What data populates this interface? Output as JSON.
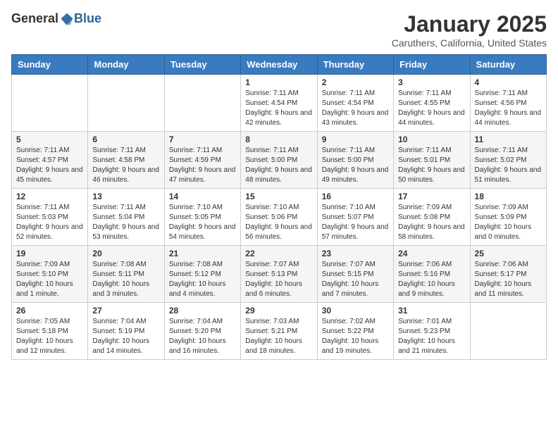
{
  "header": {
    "logo_general": "General",
    "logo_blue": "Blue",
    "month_title": "January 2025",
    "location": "Caruthers, California, United States"
  },
  "weekdays": [
    "Sunday",
    "Monday",
    "Tuesday",
    "Wednesday",
    "Thursday",
    "Friday",
    "Saturday"
  ],
  "weeks": [
    [
      {
        "day": "",
        "info": ""
      },
      {
        "day": "",
        "info": ""
      },
      {
        "day": "",
        "info": ""
      },
      {
        "day": "1",
        "info": "Sunrise: 7:11 AM\nSunset: 4:54 PM\nDaylight: 9 hours and 42 minutes."
      },
      {
        "day": "2",
        "info": "Sunrise: 7:11 AM\nSunset: 4:54 PM\nDaylight: 9 hours and 43 minutes."
      },
      {
        "day": "3",
        "info": "Sunrise: 7:11 AM\nSunset: 4:55 PM\nDaylight: 9 hours and 44 minutes."
      },
      {
        "day": "4",
        "info": "Sunrise: 7:11 AM\nSunset: 4:56 PM\nDaylight: 9 hours and 44 minutes."
      }
    ],
    [
      {
        "day": "5",
        "info": "Sunrise: 7:11 AM\nSunset: 4:57 PM\nDaylight: 9 hours and 45 minutes."
      },
      {
        "day": "6",
        "info": "Sunrise: 7:11 AM\nSunset: 4:58 PM\nDaylight: 9 hours and 46 minutes."
      },
      {
        "day": "7",
        "info": "Sunrise: 7:11 AM\nSunset: 4:59 PM\nDaylight: 9 hours and 47 minutes."
      },
      {
        "day": "8",
        "info": "Sunrise: 7:11 AM\nSunset: 5:00 PM\nDaylight: 9 hours and 48 minutes."
      },
      {
        "day": "9",
        "info": "Sunrise: 7:11 AM\nSunset: 5:00 PM\nDaylight: 9 hours and 49 minutes."
      },
      {
        "day": "10",
        "info": "Sunrise: 7:11 AM\nSunset: 5:01 PM\nDaylight: 9 hours and 50 minutes."
      },
      {
        "day": "11",
        "info": "Sunrise: 7:11 AM\nSunset: 5:02 PM\nDaylight: 9 hours and 51 minutes."
      }
    ],
    [
      {
        "day": "12",
        "info": "Sunrise: 7:11 AM\nSunset: 5:03 PM\nDaylight: 9 hours and 52 minutes."
      },
      {
        "day": "13",
        "info": "Sunrise: 7:11 AM\nSunset: 5:04 PM\nDaylight: 9 hours and 53 minutes."
      },
      {
        "day": "14",
        "info": "Sunrise: 7:10 AM\nSunset: 5:05 PM\nDaylight: 9 hours and 54 minutes."
      },
      {
        "day": "15",
        "info": "Sunrise: 7:10 AM\nSunset: 5:06 PM\nDaylight: 9 hours and 56 minutes."
      },
      {
        "day": "16",
        "info": "Sunrise: 7:10 AM\nSunset: 5:07 PM\nDaylight: 9 hours and 57 minutes."
      },
      {
        "day": "17",
        "info": "Sunrise: 7:09 AM\nSunset: 5:08 PM\nDaylight: 9 hours and 58 minutes."
      },
      {
        "day": "18",
        "info": "Sunrise: 7:09 AM\nSunset: 5:09 PM\nDaylight: 10 hours and 0 minutes."
      }
    ],
    [
      {
        "day": "19",
        "info": "Sunrise: 7:09 AM\nSunset: 5:10 PM\nDaylight: 10 hours and 1 minute."
      },
      {
        "day": "20",
        "info": "Sunrise: 7:08 AM\nSunset: 5:11 PM\nDaylight: 10 hours and 3 minutes."
      },
      {
        "day": "21",
        "info": "Sunrise: 7:08 AM\nSunset: 5:12 PM\nDaylight: 10 hours and 4 minutes."
      },
      {
        "day": "22",
        "info": "Sunrise: 7:07 AM\nSunset: 5:13 PM\nDaylight: 10 hours and 6 minutes."
      },
      {
        "day": "23",
        "info": "Sunrise: 7:07 AM\nSunset: 5:15 PM\nDaylight: 10 hours and 7 minutes."
      },
      {
        "day": "24",
        "info": "Sunrise: 7:06 AM\nSunset: 5:16 PM\nDaylight: 10 hours and 9 minutes."
      },
      {
        "day": "25",
        "info": "Sunrise: 7:06 AM\nSunset: 5:17 PM\nDaylight: 10 hours and 11 minutes."
      }
    ],
    [
      {
        "day": "26",
        "info": "Sunrise: 7:05 AM\nSunset: 5:18 PM\nDaylight: 10 hours and 12 minutes."
      },
      {
        "day": "27",
        "info": "Sunrise: 7:04 AM\nSunset: 5:19 PM\nDaylight: 10 hours and 14 minutes."
      },
      {
        "day": "28",
        "info": "Sunrise: 7:04 AM\nSunset: 5:20 PM\nDaylight: 10 hours and 16 minutes."
      },
      {
        "day": "29",
        "info": "Sunrise: 7:03 AM\nSunset: 5:21 PM\nDaylight: 10 hours and 18 minutes."
      },
      {
        "day": "30",
        "info": "Sunrise: 7:02 AM\nSunset: 5:22 PM\nDaylight: 10 hours and 19 minutes."
      },
      {
        "day": "31",
        "info": "Sunrise: 7:01 AM\nSunset: 5:23 PM\nDaylight: 10 hours and 21 minutes."
      },
      {
        "day": "",
        "info": ""
      }
    ]
  ]
}
